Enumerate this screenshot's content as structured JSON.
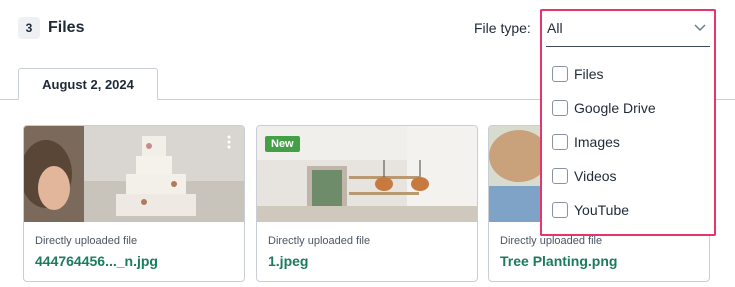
{
  "header": {
    "count": "3",
    "title": "Files",
    "filter_label": "File type:",
    "filter_value": "All"
  },
  "filter_options": [
    {
      "label": "Files",
      "checked": false
    },
    {
      "label": "Google Drive",
      "checked": false
    },
    {
      "label": "Images",
      "checked": false
    },
    {
      "label": "Videos",
      "checked": false
    },
    {
      "label": "YouTube",
      "checked": false
    }
  ],
  "tabs": [
    {
      "label": "August 2, 2024",
      "active": true
    }
  ],
  "files": [
    {
      "source": "Directly uploaded file",
      "name": "444764456..._n.jpg",
      "badge": ""
    },
    {
      "source": "Directly uploaded file",
      "name": "1.jpeg",
      "badge": "New"
    },
    {
      "source": "Directly uploaded file",
      "name": "Tree Planting.png",
      "badge": ""
    }
  ],
  "colors": {
    "highlight_border": "#e8336b",
    "file_name": "#1c7a5f",
    "new_badge": "#43a047"
  },
  "icons": {
    "dropdown": "chevron-down-icon",
    "card_menu": "more-vertical-icon"
  }
}
